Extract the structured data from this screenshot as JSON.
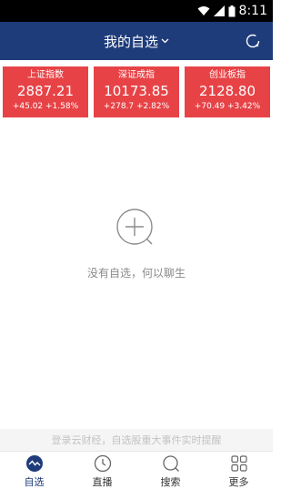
{
  "status_bar": {
    "time": "8:11"
  },
  "nav": {
    "title": "我的自选"
  },
  "indices": [
    {
      "name": "上证指数",
      "value": "2887.21",
      "change": "+45.02  +1.58%"
    },
    {
      "name": "深证成指",
      "value": "10173.85",
      "change": "+278.7  +2.82%"
    },
    {
      "name": "创业板指",
      "value": "2128.80",
      "change": "+70.49  +3.42%"
    }
  ],
  "empty_state": {
    "message": "没有自选，何以聊生"
  },
  "banner": {
    "text": "登录云财经，自选股重大事件实时提醒"
  },
  "tabs": [
    {
      "label": "自选",
      "icon": "pulse-icon",
      "active": true
    },
    {
      "label": "直播",
      "icon": "clock-icon",
      "active": false
    },
    {
      "label": "搜索",
      "icon": "search-icon",
      "active": false
    },
    {
      "label": "更多",
      "icon": "grid-icon",
      "active": false
    }
  ],
  "colors": {
    "nav_bg": "#1e3b7a",
    "index_card_bg": "#e74347",
    "active_tab": "#1e3b7a"
  }
}
